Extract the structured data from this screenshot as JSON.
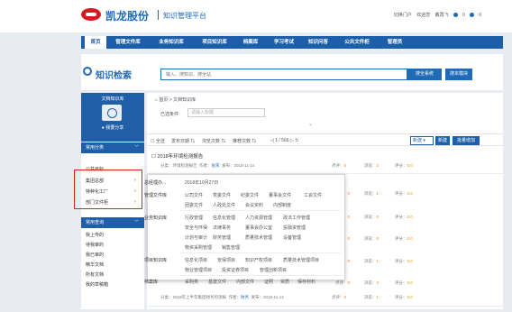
{
  "header": {
    "brand": "凯龙股份",
    "platform": "知识管理平台",
    "portal": "切换门户",
    "welcome": "欢迎您",
    "user": "戴再飞",
    "count1": "0",
    "count2": "0",
    "brand_color": "#1f6bb5",
    "logo_color": "#d71a21"
  },
  "nav": {
    "items": [
      "首页",
      "管理文件库",
      "业务知识库",
      "项目知识库",
      "档案库",
      "学习考试",
      "知识问答",
      "公共文件柜",
      "管理员"
    ]
  },
  "search": {
    "logo_text": "知识检索",
    "placeholder": "输入、搜知识、搜全站",
    "search_btn": "搜全系统",
    "adv_btn": "搜本模块"
  },
  "sidebar": {
    "title": "文档知识库",
    "share": "我要分享",
    "common_class_label": "常用分类",
    "public_label": "公共目标",
    "items": [
      "集团总部",
      "特种化工厂",
      "部门文件柜"
    ],
    "common_query_label": "常用查询",
    "queries": [
      "我上传的",
      "待我审的",
      "我已审的",
      "精华文档",
      "所有文档",
      "我的草稿箱"
    ]
  },
  "main": {
    "crumb_home": "首页",
    "crumb_sep": ">",
    "crumb_current": "文档知识库",
    "selected_label": "已选条件:",
    "selected_placeholder": "请输入标题",
    "collapse_icon": "chevron-down",
    "toolbar": {
      "select_all": "全选",
      "publish_date": "发布日期",
      "browse_count": "浏览次数",
      "recommend_count": "推荐次数",
      "page": "1 / 566",
      "type_select": "新建",
      "new_btn": "新建",
      "batch_btn": "批量增加"
    },
    "rows": [
      {
        "title": "2018年环境检测报告",
        "meta_class": "分类：环境检测报告",
        "meta_author_label": "作者：",
        "meta_author": "张荣",
        "meta_date": "发布：2018-11-14",
        "score_label": "点评：",
        "score": "0",
        "views_label": "浏览：",
        "views": "2",
        "rating_label": "评分：",
        "rating": "0.0"
      },
      {
        "title": "",
        "meta_class": "分类：2018年上半年集团财务检测报",
        "meta_author_label": "作者：",
        "meta_author": "财务",
        "meta_date": "发布：2018-11-14",
        "score_label": "点评：",
        "score": "0",
        "views_label": "浏览：",
        "views": "1",
        "rating_label": "评分：",
        "rating": "0.0"
      }
    ],
    "side_stats": [
      {
        "score": "0",
        "views": "1",
        "rating": "0.0"
      },
      {
        "score": "0",
        "views": "0",
        "rating": "0.0"
      },
      {
        "score": "0",
        "views": "0",
        "rating": "0.0"
      },
      {
        "score": "0",
        "views": "1",
        "rating": "0.0"
      },
      {
        "score": "0",
        "views": "3",
        "rating": "0.0"
      },
      {
        "score": "0",
        "views": "0",
        "rating": "0.0"
      }
    ]
  },
  "popup": {
    "head_label": "总经理办...",
    "date": "2018年10月27日",
    "cat1": "管理文件库",
    "cat1_links": [
      "公司文件",
      "党委文件",
      "纪委文件",
      "董事会文件",
      "工会文件",
      "团委文件",
      "人政处文件",
      "会议资料",
      "内部制度"
    ],
    "cat2": "业务知识库",
    "cat2_links": [
      "行政管理",
      "信息化管理",
      "人力资源管理",
      "政法工作管理",
      "安全与环保",
      "法律事务",
      "董事会办公室",
      "投融资管理",
      "计划与审计",
      "财务管理",
      "质量技术管理",
      "设备管理",
      "物资采购管理",
      "销售管理"
    ],
    "cat3": "项目知识库",
    "cat3_links": [
      "信息化项目",
      "安保项目",
      "知识产权项目",
      "质量技术管理项目",
      "物业管理项目",
      "投资证券项目",
      "管理创新项目"
    ],
    "cat4": "档案库",
    "cat4_links": [
      "采购类",
      "基建文件",
      "内部文件",
      "证照",
      "资质",
      "保存材料"
    ]
  }
}
